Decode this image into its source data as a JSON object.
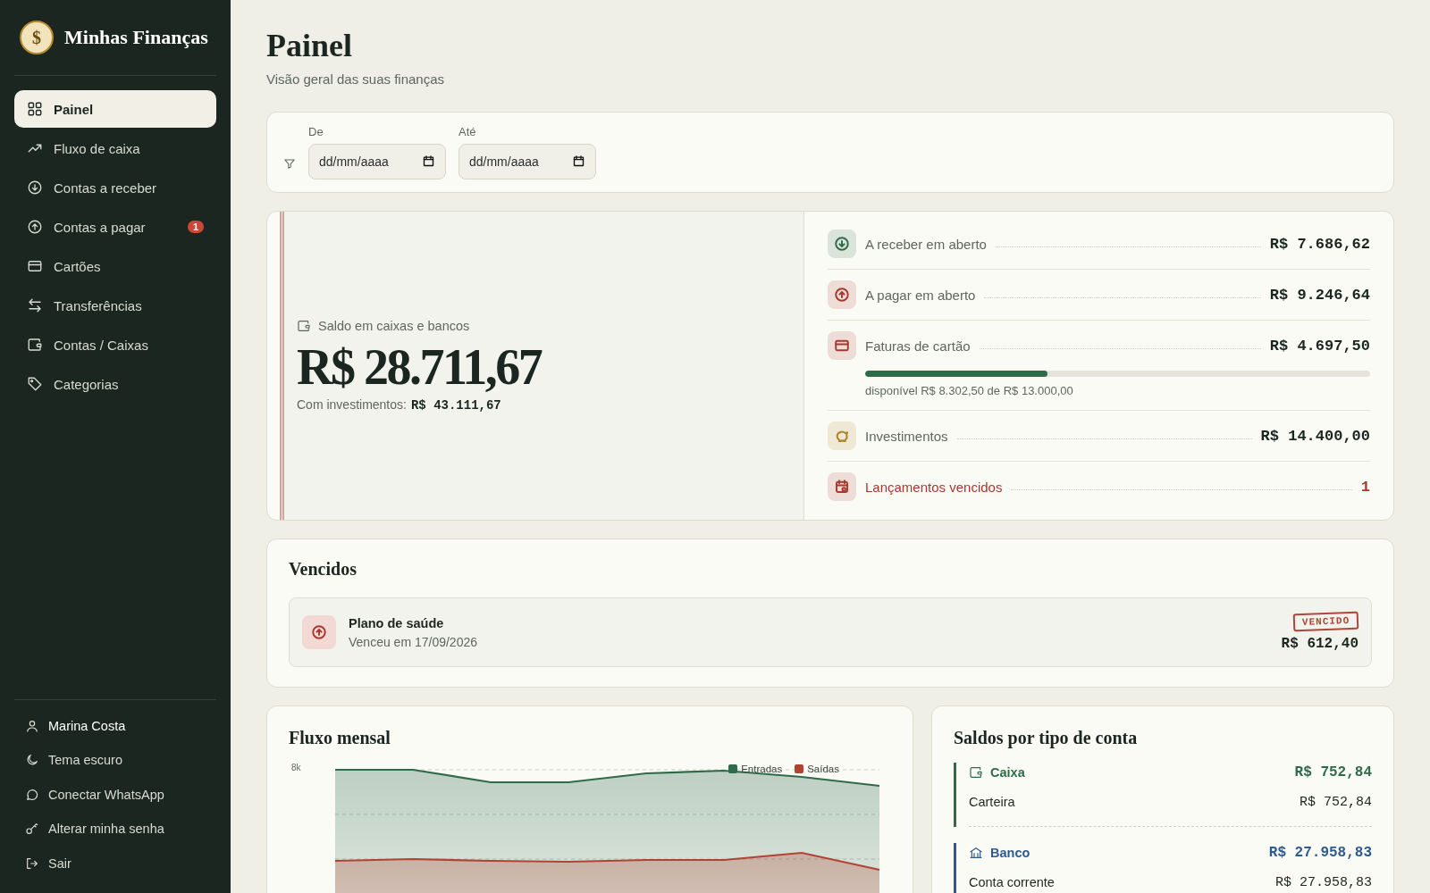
{
  "app": {
    "name": "Minhas Finanças",
    "logo_symbol": "$"
  },
  "nav": [
    {
      "label": "Painel",
      "selected": true
    },
    {
      "label": "Fluxo de caixa",
      "selected": false
    },
    {
      "label": "Contas a receber",
      "selected": false
    },
    {
      "label": "Contas a pagar",
      "selected": false,
      "badge": "1"
    },
    {
      "label": "Cartões",
      "selected": false
    },
    {
      "label": "Transferências",
      "selected": false
    },
    {
      "label": "Contas / Caixas",
      "selected": false
    },
    {
      "label": "Categorias",
      "selected": false
    }
  ],
  "user_menu": [
    {
      "kind": "user",
      "label": "Marina Costa"
    },
    {
      "kind": "action",
      "label": "Tema escuro"
    },
    {
      "kind": "action",
      "label": "Conectar WhatsApp"
    },
    {
      "kind": "action",
      "label": "Alterar minha senha"
    },
    {
      "kind": "action",
      "label": "Sair"
    }
  ],
  "page": {
    "title": "Painel",
    "subtitle": "Visão geral das suas finanças"
  },
  "filter": [
    {
      "label": "De",
      "placeholder": "dd/mm/aaaa"
    },
    {
      "label": "Até",
      "placeholder": "dd/mm/aaaa"
    }
  ],
  "balance": {
    "label": "Saldo em caixas e bancos",
    "amount": "R$ 28.711,67",
    "with_investments_label": "Com investimentos:",
    "with_investments": "R$ 43.111,67"
  },
  "summary": [
    {
      "kind": "metric",
      "label": "A receber em aberto",
      "value": "R$ 7.686,62",
      "color": "#2f6b4a"
    },
    {
      "kind": "metric",
      "label": "A pagar em aberto",
      "value": "R$ 9.246,64",
      "color": "#a8392f"
    },
    {
      "kind": "card",
      "label": "Faturas de cartão",
      "value": "R$ 4.697,50",
      "color": "#a8392f",
      "level": 0.361,
      "note": "disponível R$ 8.302,50 de R$ 13.000,00"
    },
    {
      "kind": "metric",
      "label": "Investimentos",
      "value": "R$ 14.400,00",
      "color": "#a9852a"
    },
    {
      "kind": "count",
      "label": "Lançamentos vencidos",
      "value": "1",
      "color": "#a8392f"
    }
  ],
  "overdue": {
    "title": "Vencidos",
    "items": [
      {
        "title": "Plano de saúde",
        "subtitle": "Venceu em 17/09/2026",
        "stamp": "VENCIDO",
        "amount": "R$ 612,40"
      }
    ]
  },
  "monthly_flow": {
    "title": "Fluxo mensal",
    "y_tick": "8k",
    "legend": [
      {
        "name": "Entradas",
        "color": "#2f6b4a"
      },
      {
        "name": "Saídas",
        "color": "#b04434"
      }
    ]
  },
  "balances_by_type": {
    "title": "Saldos por tipo de conta",
    "groups": [
      {
        "name": "Caixa",
        "total": "R$ 752,84",
        "color": "#2f6b4a",
        "accounts": [
          {
            "name": "Carteira",
            "amount": "R$ 752,84"
          }
        ]
      },
      {
        "name": "Banco",
        "total": "R$ 27.958,83",
        "color": "#2f5a8f",
        "accounts": [
          {
            "name": "Conta corrente",
            "amount": "R$ 27.958,83"
          }
        ]
      }
    ]
  }
}
